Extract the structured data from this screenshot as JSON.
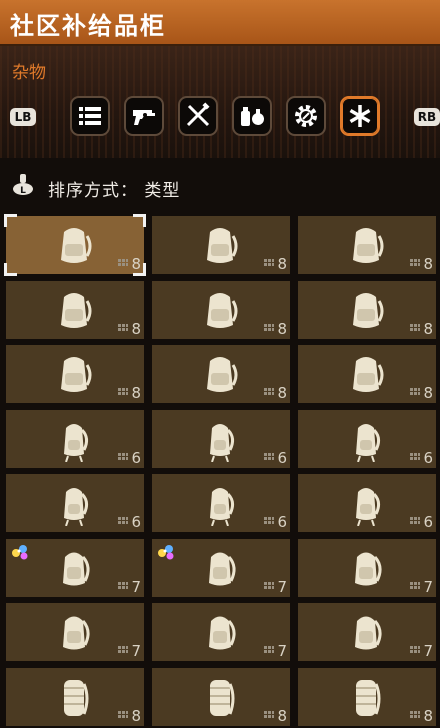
{
  "title": "社区补给品柜",
  "category": "杂物",
  "bumpers": {
    "left": "LB",
    "right": "RB"
  },
  "tabs": [
    {
      "icon": "list-icon",
      "active": false
    },
    {
      "icon": "revolver-icon",
      "active": false
    },
    {
      "icon": "crossed-tools-icon",
      "active": false
    },
    {
      "icon": "consumables-icon",
      "active": false
    },
    {
      "icon": "gear-icon",
      "active": false
    },
    {
      "icon": "asterisk-icon",
      "active": true
    }
  ],
  "sort": {
    "label": "排序方式：",
    "value": "类型",
    "icon": "left-stick-icon"
  },
  "items": [
    {
      "icon": "large-backpack-icon",
      "qty": "8",
      "selected": true
    },
    {
      "icon": "large-backpack-icon",
      "qty": "8"
    },
    {
      "icon": "large-backpack-icon",
      "qty": "8"
    },
    {
      "icon": "large-backpack-icon",
      "qty": "8"
    },
    {
      "icon": "large-backpack-icon",
      "qty": "8"
    },
    {
      "icon": "large-backpack-icon",
      "qty": "8"
    },
    {
      "icon": "large-backpack-icon",
      "qty": "8"
    },
    {
      "icon": "large-backpack-icon",
      "qty": "8"
    },
    {
      "icon": "large-backpack-icon",
      "qty": "8"
    },
    {
      "icon": "small-backpack-icon",
      "qty": "6"
    },
    {
      "icon": "small-backpack-icon",
      "qty": "6"
    },
    {
      "icon": "small-backpack-icon",
      "qty": "6"
    },
    {
      "icon": "small-backpack-icon",
      "qty": "6"
    },
    {
      "icon": "small-backpack-icon",
      "qty": "6"
    },
    {
      "icon": "small-backpack-icon",
      "qty": "6"
    },
    {
      "icon": "medium-backpack-icon",
      "qty": "7",
      "gem": true
    },
    {
      "icon": "medium-backpack-icon",
      "qty": "7",
      "gem": true
    },
    {
      "icon": "medium-backpack-icon",
      "qty": "7"
    },
    {
      "icon": "medium-backpack-icon",
      "qty": "7"
    },
    {
      "icon": "medium-backpack-icon",
      "qty": "7"
    },
    {
      "icon": "medium-backpack-icon",
      "qty": "7"
    },
    {
      "icon": "frame-backpack-icon",
      "qty": "8"
    },
    {
      "icon": "frame-backpack-icon",
      "qty": "8"
    },
    {
      "icon": "frame-backpack-icon",
      "qty": "8"
    }
  ],
  "colors": {
    "accent": "#e07a2a",
    "cell": "#4b3a22",
    "selected": "#876235",
    "pack": "#ece4cf"
  }
}
